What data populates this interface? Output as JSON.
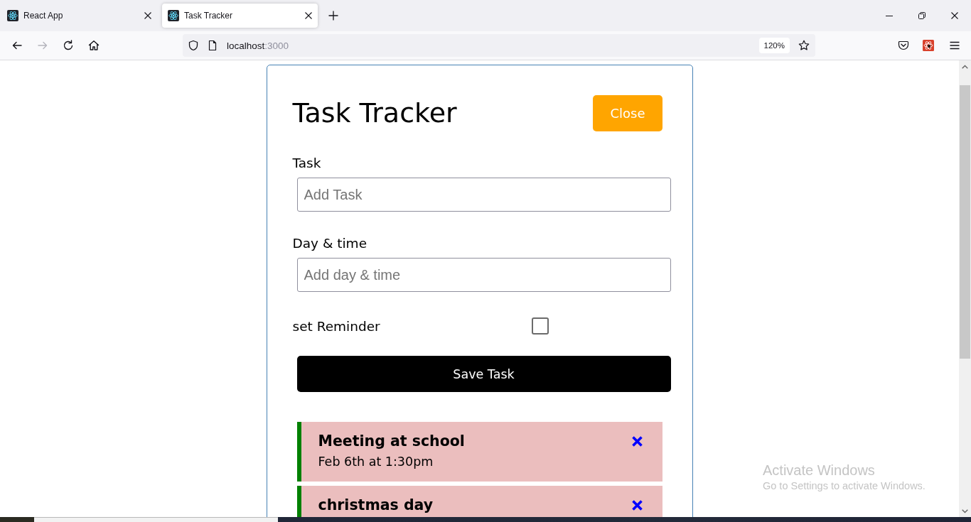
{
  "browser": {
    "tabs": [
      {
        "title": "React App",
        "selected": false
      },
      {
        "title": "Task Tracker",
        "selected": true
      }
    ],
    "toolbar": [
      {
        "kind": "back",
        "disabled": false
      },
      {
        "kind": "forward",
        "disabled": true
      },
      {
        "kind": "reload",
        "disabled": false
      },
      {
        "kind": "home",
        "disabled": false
      }
    ],
    "address": {
      "host": "localhost",
      "port": ":3000"
    },
    "zoom": "120%"
  },
  "app": {
    "title": "Task Tracker",
    "toggle_button": "Close",
    "form": {
      "fields": [
        {
          "label": "Task",
          "placeholder": "Add Task"
        },
        {
          "label": "Day & time",
          "placeholder": "Add day & time"
        }
      ],
      "reminder": {
        "label": "set Reminder",
        "checked": false
      },
      "submit": "Save Task"
    },
    "tasks": [
      {
        "text": "Meeting at school",
        "day": "Feb 6th at 1:30pm",
        "reminder": true
      },
      {
        "text": "christmas day",
        "reminder": true
      }
    ]
  },
  "os_notice": {
    "title": "Activate Windows",
    "text": "Go to Settings to activate Windows."
  }
}
